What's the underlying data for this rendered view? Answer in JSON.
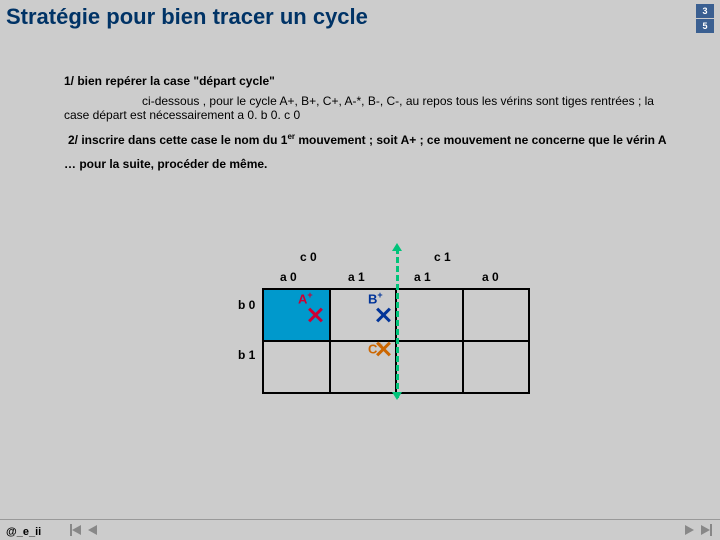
{
  "title": "Stratégie pour bien tracer un cycle",
  "corner": {
    "top": "3",
    "bottom": "5"
  },
  "text": {
    "p1": "1/ bien repérer la case \"départ cycle\"",
    "p2a": "1/ bien repérer",
    "p2b": "ci-dessous , pour le cycle A+, B+, C+, A-*, B-, C-, au repos tous les vérins sont tiges rentrées ; la case départ est nécessairement a 0. b 0. c 0",
    "p3a": "2/ inscrire dans cette case le nom du 1",
    "p3sup": "er",
    "p3b": " mouvement ; soit A+ ; ce mouvement ne concerne que le vérin A",
    "p4": "… pour la suite, procéder de même."
  },
  "chart_data": {
    "type": "table",
    "col_groups": [
      "c 0",
      "c 1"
    ],
    "columns": [
      "a 0",
      "a 1",
      "a 1",
      "a 0"
    ],
    "rows": [
      "b 0",
      "b 1"
    ],
    "highlighted_cell": [
      0,
      0
    ],
    "moves": [
      {
        "label": "A",
        "sup": "+",
        "cell": [
          0,
          0
        ],
        "color": "#cc0033"
      },
      {
        "label": "B",
        "sup": "+",
        "cell": [
          0,
          1
        ],
        "color": "#003399"
      },
      {
        "label": "C",
        "sup": "+",
        "cell": [
          1,
          1
        ],
        "color": "#cc6600"
      }
    ],
    "divider_after_col": 1
  },
  "footer": {
    "handle": "@_e_ii"
  }
}
